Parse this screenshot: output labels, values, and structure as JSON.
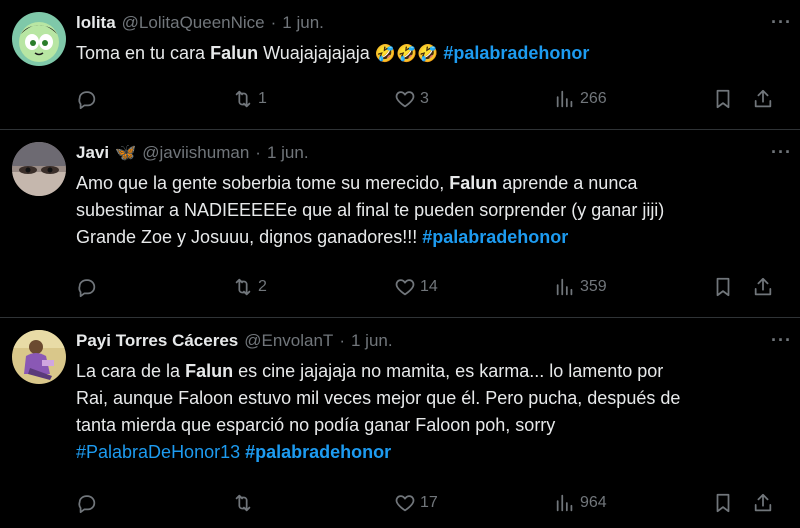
{
  "tweets": [
    {
      "name": "lolita",
      "handle": "@LolitaQueenNice",
      "dot": "·",
      "time": "1 jun.",
      "text_pre": "Toma en tu cara ",
      "text_bold": "Falun",
      "text_post": " Wuajajajajaja ",
      "emojis": "🤣🤣🤣",
      "hashtag": "#palabradehonor",
      "reposts": "1",
      "likes": "3",
      "views": "266"
    },
    {
      "name": "Javi",
      "name_emoji": "🦋",
      "handle": "@javiishuman",
      "dot": "·",
      "time": "1 jun.",
      "line1_pre": "Amo que la gente soberbia  tome su merecido, ",
      "line1_bold": "Falun",
      "line1_post": " aprende a nunca",
      "line2": "subestimar a NADIEEEEEe que al final te pueden sorprender (y ganar jiji)",
      "line3": "Grande Zoe y Josuuu, dignos ganadores!!! ",
      "hashtag": "#palabradehonor",
      "reposts": "2",
      "likes": "14",
      "views": "359"
    },
    {
      "name": "Payi Torres Cáceres",
      "handle": "@EnvolanT",
      "dot": "·",
      "time": "1 jun.",
      "line1_pre": "La cara de la ",
      "line1_bold": "Falun",
      "line1_post": " es cine jajajaja no mamita, es karma... lo lamento por",
      "line2": "Rai, aunque Faloon estuvo mil veces mejor que él. Pero pucha, después de",
      "line3": "tanta mierda que esparció no podía ganar Faloon poh, sorry",
      "hashtag1": "#PalabraDeHonor13",
      "hashtag2": "#palabradehonor",
      "likes": "17",
      "views": "964"
    }
  ],
  "more_label": "···",
  "colors": {
    "background": "#000000",
    "text": "#e7e9ea",
    "muted": "#71767b",
    "link": "#1d9bf0",
    "divider": "#2f3336"
  },
  "icons": [
    "reply-icon",
    "repost-icon",
    "like-icon",
    "views-icon",
    "bookmark-icon",
    "share-icon",
    "more-icon"
  ]
}
